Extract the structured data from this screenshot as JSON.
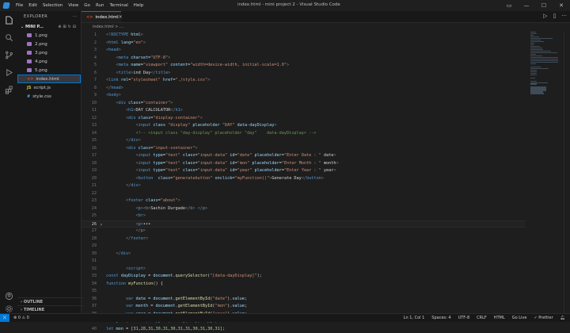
{
  "window": {
    "title": "index.html - mini project 2 - Visual Studio Code",
    "menu": [
      "File",
      "Edit",
      "Selection",
      "View",
      "Go",
      "Run",
      "Terminal",
      "Help"
    ]
  },
  "sidebar": {
    "header": "EXPLORER",
    "folder": "MINI P...",
    "files": [
      {
        "name": "1.png",
        "type": "image"
      },
      {
        "name": "2.png",
        "type": "image"
      },
      {
        "name": "3.png",
        "type": "image"
      },
      {
        "name": "4.png",
        "type": "image"
      },
      {
        "name": "5.png",
        "type": "image"
      },
      {
        "name": "index.html",
        "type": "html",
        "active": true
      },
      {
        "name": "script.js",
        "type": "js"
      },
      {
        "name": "style.css",
        "type": "css"
      }
    ],
    "outline": "OUTLINE",
    "timeline": "TIMELINE"
  },
  "tabs": [
    {
      "label": "index.html"
    }
  ],
  "breadcrumb": "index.html > ...",
  "editor": {
    "current_line": 26,
    "lines": [
      {
        "n": 1,
        "html": "<span class='p'>&lt;!</span><span class='t'>DOCTYPE</span> <span class='a'>html</span><span class='p'>&gt;</span>"
      },
      {
        "n": 2,
        "html": "<span class='p'>&lt;</span><span class='t'>html</span> <span class='a'>lang</span>=<span class='s'>\"en\"</span><span class='p'>&gt;</span>"
      },
      {
        "n": 3,
        "html": "<span class='p'>&lt;</span><span class='t'>head</span><span class='p'>&gt;</span>"
      },
      {
        "n": 4,
        "html": "    <span class='p'>&lt;</span><span class='t'>meta</span> <span class='a'>charset</span>=<span class='s'>\"UTF-8\"</span><span class='p'>&gt;</span>"
      },
      {
        "n": 5,
        "html": "    <span class='p'>&lt;</span><span class='t'>meta</span> <span class='a'>name</span>=<span class='s'>\"viewport\"</span> <span class='a'>content</span>=<span class='s'>\"width=device-width, initial-scale=1.0\"</span><span class='p'>&gt;</span>"
      },
      {
        "n": 6,
        "html": "    <span class='p'>&lt;</span><span class='t'>title</span><span class='p'>&gt;</span>ind Day<span class='p'>&lt;/</span><span class='t'>title</span><span class='p'>&gt;</span>"
      },
      {
        "n": 7,
        "html": "<span class='p'>&lt;</span><span class='t'>link</span> <span class='a'>rel</span>=<span class='s'>\"stylesheet\"</span> <span class='a'>href</span>=<span class='s'>\"./style.css\"</span><span class='p'>&gt;</span>"
      },
      {
        "n": 8,
        "html": "<span class='p'>&lt;/</span><span class='t'>head</span><span class='p'>&gt;</span>"
      },
      {
        "n": 9,
        "html": "<span class='p'>&lt;</span><span class='t'>body</span><span class='p'>&gt;</span>"
      },
      {
        "n": 10,
        "html": "    <span class='p'>&lt;</span><span class='t'>div</span> <span class='a'>class</span>=<span class='s'>\"container\"</span><span class='p'>&gt;</span>"
      },
      {
        "n": 11,
        "html": "        <span class='p'>&lt;</span><span class='t'>h1</span><span class='p'>&gt;</span>DAY CALCULATOR<span class='p'>&lt;/</span><span class='t'>h1</span><span class='p'>&gt;</span>"
      },
      {
        "n": 12,
        "html": "        <span class='p'>&lt;</span><span class='t'>div</span> <span class='a'>class</span>=<span class='s'>\"display-container\"</span><span class='p'>&gt;</span>"
      },
      {
        "n": 13,
        "html": "            <span class='p'>&lt;</span><span class='t'>input</span> <span class='a'>class</span> <span class='s'>\"display\"</span> <span class='a'>placeholder</span> <span class='s'>\"DAY\"</span> <span class='a'>data-dayDisplay</span><span class='p'>&gt;</span>"
      },
      {
        "n": 14,
        "html": "            <span class='c'>&lt;!-- &lt;input class \"day-display\" placeholder \"day\"    data-dayDisplay&gt; --&gt;</span>"
      },
      {
        "n": 15,
        "html": "        <span class='p'>&lt;/</span><span class='t'>div</span><span class='p'>&gt;</span>"
      },
      {
        "n": 16,
        "html": "        <span class='p'>&lt;</span><span class='t'>div</span> <span class='a'>class</span>=<span class='s'>\"input-container\"</span><span class='p'>&gt;</span>"
      },
      {
        "n": 17,
        "html": "            <span class='p'>&lt;</span><span class='t'>input</span> <span class='a'>type</span>=<span class='s'>\"text\"</span> <span class='a'>class</span>=<span class='s'>\"input-data\"</span> <span class='a'>id</span>=<span class='s'>\"date\"</span> <span class='a'>placeholder</span>=<span class='s'>\"Enter Date : \"</span> date<span class='p'>&gt;</span>"
      },
      {
        "n": 18,
        "html": "            <span class='p'>&lt;</span><span class='t'>input</span> <span class='a'>type</span>=<span class='s'>\"text\"</span> <span class='a'>class</span>=<span class='s'>\"input-data\"</span> <span class='a'>id</span>=<span class='s'>\"mon\"</span> <span class='a'>placeholder</span>=<span class='s'>\"Enter Month : \"</span> month<span class='p'>&gt;</span>"
      },
      {
        "n": 19,
        "html": "            <span class='p'>&lt;</span><span class='t'>input</span> <span class='a'>type</span>=<span class='s'>\"text\"</span> <span class='a'>class</span>=<span class='s'>\"input-data\"</span> <span class='a'>id</span>=<span class='s'>\"year\"</span> <span class='a'>placeholder</span>=<span class='s'>\"Enter Year : \"</span> year<span class='p'>&gt;</span>"
      },
      {
        "n": 20,
        "html": "            <span class='p'>&lt;</span><span class='t'>button</span>  <span class='a'>class</span>=<span class='s'>\"generatebutton\"</span> <span class='a'>onclick</span>=<span class='s'>\"myFunction()\"</span><span class='p'>&gt;</span>Generate Day<span class='p'>&lt;/</span><span class='t'>button</span><span class='p'>&gt;</span>"
      },
      {
        "n": 21,
        "html": "        <span class='p'>&lt;/</span><span class='t'>div</span><span class='p'>&gt;</span>"
      },
      {
        "n": 22,
        "html": ""
      },
      {
        "n": 23,
        "html": "        <span class='p'>&lt;</span><span class='t'>footer</span> <span class='a'>class</span>=<span class='s'>\"about\"</span><span class='p'>&gt;</span>"
      },
      {
        "n": 24,
        "html": "            <span class='p'>&lt;</span><span class='t'>p</span><span class='p'>&gt;&lt;</span><span class='t'>b</span><span class='p'>&gt;</span>Sachin Durgade<span class='p'>&lt;/</span><span class='t'>b</span><span class='p'>&gt;</span> <span class='p'>&lt;/</span><span class='t'>p</span><span class='p'>&gt;</span>"
      },
      {
        "n": 25,
        "html": "            <span class='p'>&lt;</span><span class='t'>br</span><span class='p'>&gt;</span>"
      },
      {
        "n": 26,
        "html": "            <span class='p'>&lt;</span><span class='t'>p</span><span class='p'>&gt;</span>•••"
      },
      {
        "n": 27,
        "html": "            <span class='p'>&lt;/</span><span class='t'>p</span><span class='p'>&gt;</span>"
      },
      {
        "n": 28,
        "html": "        <span class='p'>&lt;/</span><span class='t'>footer</span><span class='p'>&gt;</span>"
      },
      {
        "n": 29,
        "html": ""
      },
      {
        "n": 30,
        "html": "    <span class='p'>&lt;/</span><span class='t'>div</span><span class='p'>&gt;</span>"
      },
      {
        "n": 31,
        "html": ""
      },
      {
        "n": 32,
        "html": "        <span class='p'>&lt;</span><span class='t'>script</span><span class='p'>&gt;</span>"
      },
      {
        "n": 33,
        "html": "<span class='kk'>const</span> <span class='v'>dayDisplay</span> = <span class='v'>document</span>.<span class='f'>querySelector</span>(<span class='s'>\"[data-dayDisplay]\"</span>);"
      },
      {
        "n": 34,
        "html": "<span class='kk'>function</span> <span class='f'>myFunction</span>() {"
      },
      {
        "n": 35,
        "html": ""
      },
      {
        "n": 36,
        "html": "        <span class='kk'>var</span> <span class='v'>date</span> = <span class='v'>document</span>.<span class='f'>getElementById</span>(<span class='s'>\"date\"</span>).<span class='v'>value</span>;"
      },
      {
        "n": 37,
        "html": "        <span class='kk'>var</span> <span class='v'>month</span> = <span class='v'>document</span>.<span class='f'>getElementById</span>(<span class='s'>\"mon\"</span>).<span class='v'>value</span>;"
      },
      {
        "n": 38,
        "html": "        <span class='kk'>var</span> <span class='v'>year</span> = <span class='v'>document</span>.<span class='f'>getElementById</span>(<span class='s'>\"year\"</span>).<span class='v'>value</span>;"
      },
      {
        "n": 39,
        "html": "<span class='kk'>let</span> <span class='v'>year</span>,<span class='v'>modulus</span>,<span class='v'>leapyear</span>,<span class='v'>oddday</span>,<span class='v'>leap</span>,<span class='v'>leapyr</span>;"
      },
      {
        "n": 40,
        "html": "<span class='kk'>let</span> <span class='v'>mon</span> = [<span class='n'>31</span>,<span class='n'>28</span>,<span class='n'>31</span>,<span class='n'>30</span>,<span class='n'>31</span>,<span class='n'>30</span>,<span class='n'>31</span>,<span class='n'>31</span>,<span class='n'>30</span>,<span class='n'>31</span>,<span class='n'>30</span>,<span class='n'>31</span>];"
      }
    ]
  },
  "statusbar": {
    "left": [
      "⊗ 0  ⚠ 0"
    ],
    "right": [
      "Ln 1, Col 1",
      "Spaces: 4",
      "UTF-8",
      "CRLF",
      "HTML",
      "Go Live",
      "✓ Prettier"
    ]
  },
  "colors": {
    "accent": "#0078d4",
    "editor_bg": "#1e1e1e",
    "sidebar_bg": "#181818"
  }
}
